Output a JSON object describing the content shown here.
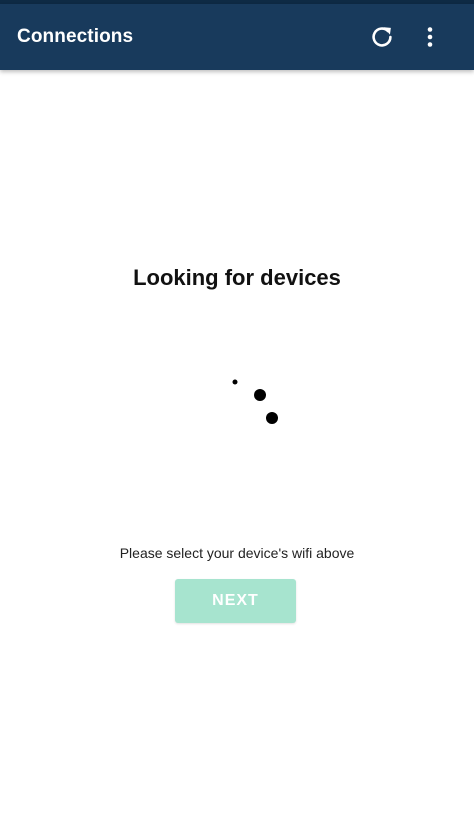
{
  "app_bar": {
    "title": "Connections",
    "actions": {
      "refresh_icon": "refresh-icon",
      "more_icon": "more-vertical-icon"
    },
    "background": "#183a5c"
  },
  "main": {
    "heading": "Looking for devices",
    "spinner_icon": "loading-dots-icon",
    "hint": "Please select your device's wifi above",
    "next_label": "NEXT",
    "next_color": "#a7e4cf"
  }
}
